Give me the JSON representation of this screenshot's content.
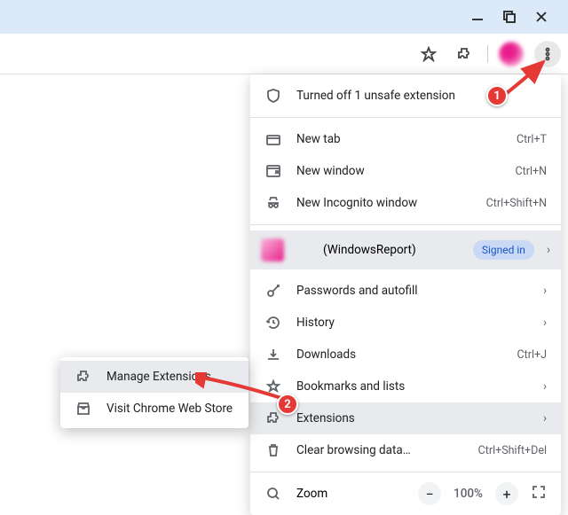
{
  "window": {
    "minimize": "minimize",
    "maximize": "maximize",
    "close": "close"
  },
  "toolbar": {
    "star": "bookmark-star",
    "extensions": "puzzle-piece",
    "more": "more-menu"
  },
  "menu": {
    "warning": "Turned off 1 unsafe extension",
    "new_tab": {
      "label": "New tab",
      "accel": "Ctrl+T"
    },
    "new_window": {
      "label": "New window",
      "accel": "Ctrl+N"
    },
    "incognito": {
      "label": "New Incognito window",
      "accel": "Ctrl+Shift+N"
    },
    "profile": {
      "name_suffix": "(WindowsReport)",
      "signed_in": "Signed in"
    },
    "passwords": {
      "label": "Passwords and autofill"
    },
    "history": {
      "label": "History"
    },
    "downloads": {
      "label": "Downloads",
      "accel": "Ctrl+J"
    },
    "bookmarks": {
      "label": "Bookmarks and lists"
    },
    "extensions": {
      "label": "Extensions"
    },
    "clear_data": {
      "label": "Clear browsing data…",
      "accel": "Ctrl+Shift+Del"
    },
    "zoom": {
      "label": "Zoom",
      "pct": "100%",
      "minus": "−",
      "plus": "+"
    }
  },
  "submenu": {
    "manage": "Manage Extensions",
    "store": "Visit Chrome Web Store"
  },
  "annotations": {
    "one": "1",
    "two": "2"
  }
}
